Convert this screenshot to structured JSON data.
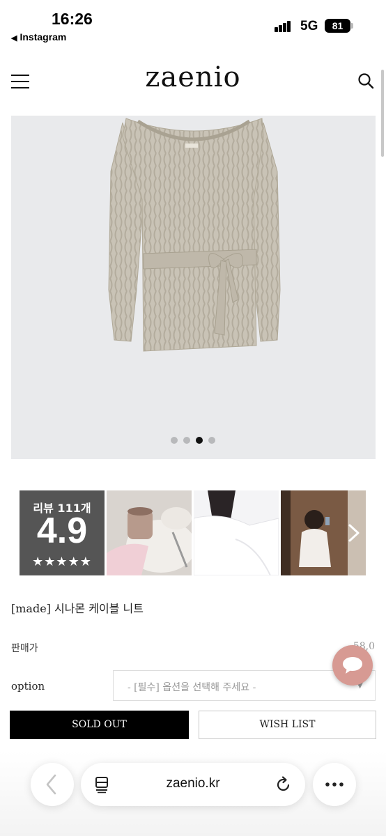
{
  "status_bar": {
    "time": "16:26",
    "back_app": "Instagram",
    "network": "5G",
    "battery": "81"
  },
  "header": {
    "logo": "zaenio",
    "menu_icon": "hamburger-menu-icon",
    "search_icon": "search-icon"
  },
  "gallery": {
    "slide_count": 4,
    "active_index": 2,
    "background_color": "#e9eaec"
  },
  "reviews": {
    "count_label": "리뷰 111개",
    "score": "4.9",
    "stars": "★★★★★",
    "next_icon": "chevron-right-icon"
  },
  "product": {
    "name": "[made] 시나몬 케이블 니트",
    "price_label": "판매가",
    "price_value": "58,0",
    "option_label": "option",
    "option_placeholder": "- [필수] 옵션을 선택해 주세요 -"
  },
  "actions": {
    "sold_out": "SOLD OUT",
    "wish_list": "WISH LIST"
  },
  "chat": {
    "icon": "chat-bubble-icon",
    "color": "#d79a93"
  },
  "browser": {
    "url": "zaenio.kr",
    "back_icon": "chevron-left-icon",
    "tabs_icon": "tabs-icon",
    "reload_icon": "reload-icon",
    "more_icon": "more-dots-icon"
  }
}
